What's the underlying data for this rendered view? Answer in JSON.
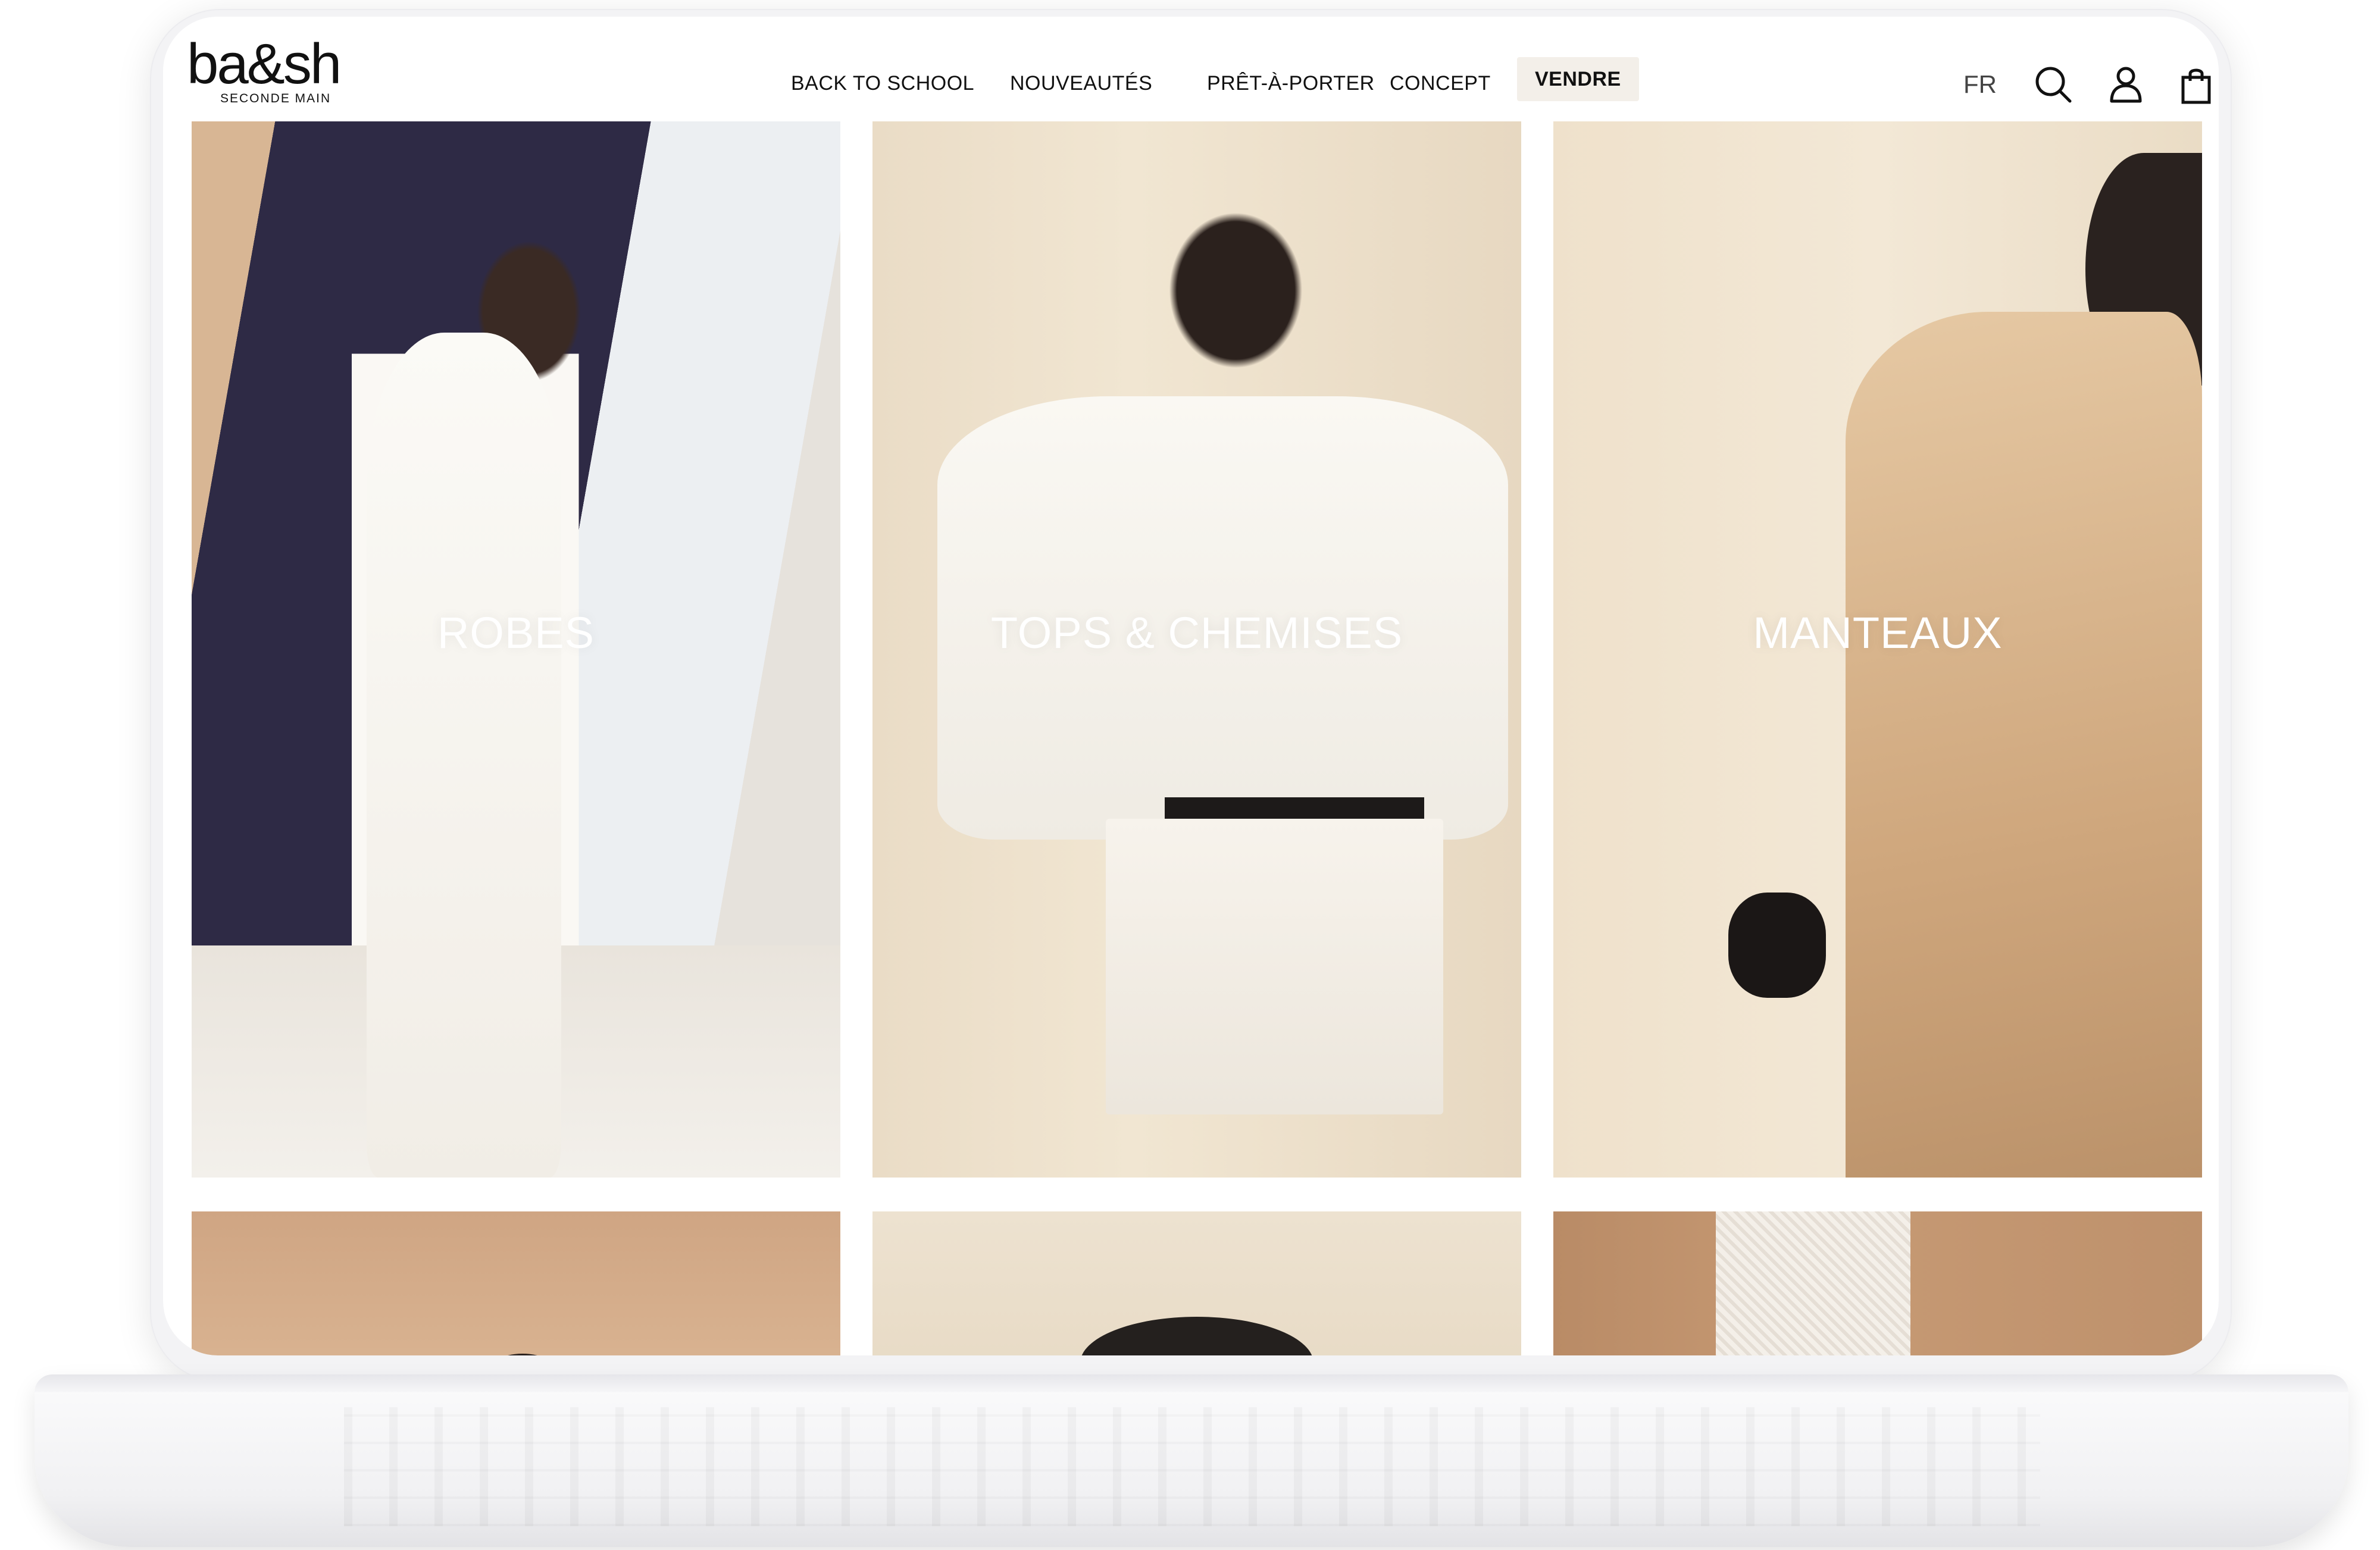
{
  "brand": {
    "name": "ba&sh",
    "tagline": "SECONDE MAIN"
  },
  "nav": {
    "items": [
      {
        "label": "BACK TO SCHOOL"
      },
      {
        "label": "NOUVEAUTÉS"
      },
      {
        "label": "PRÊT-À-PORTER"
      },
      {
        "label": "CONCEPT"
      },
      {
        "label": "VENDRE"
      }
    ]
  },
  "header": {
    "language": "FR",
    "icons": [
      "search-icon",
      "account-icon",
      "shopping-bag-icon"
    ]
  },
  "categories": [
    {
      "label": "ROBES"
    },
    {
      "label": "TOPS & CHEMISES"
    },
    {
      "label": "MANTEAUX"
    }
  ],
  "colors": {
    "vendre_highlight": "#f3efe9",
    "text": "#111111",
    "frame": "#f3f3f5"
  }
}
